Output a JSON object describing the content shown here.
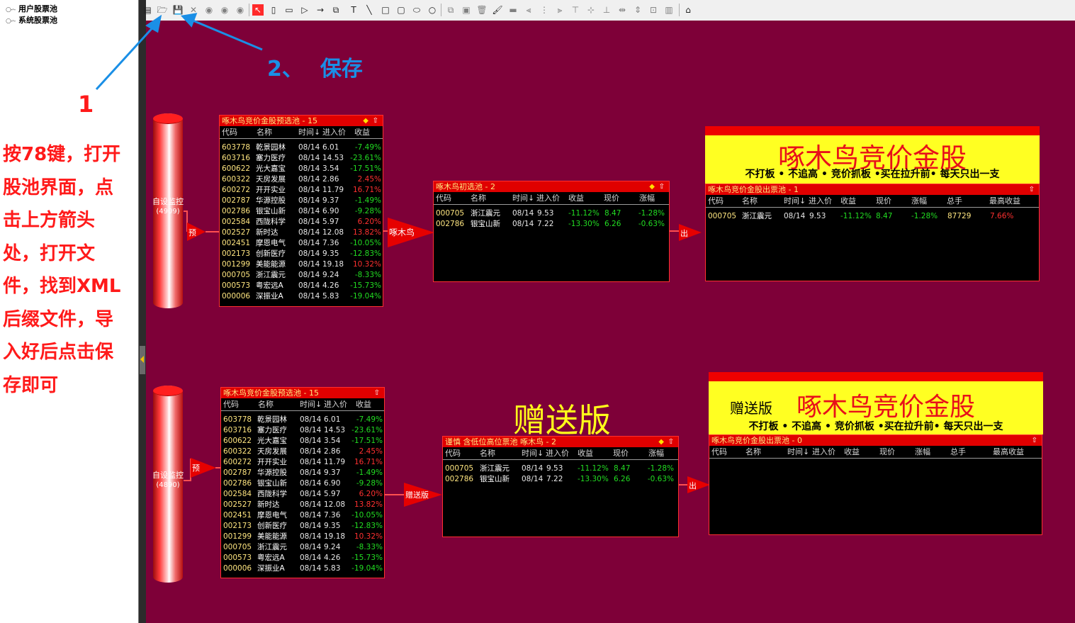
{
  "tree": {
    "items": [
      {
        "label": "用户股票池"
      },
      {
        "label": "系统股票池"
      }
    ]
  },
  "annotations": {
    "step1": "1",
    "step2_num": "2、",
    "step2_label": "保存",
    "instruction_lines": [
      "按78键，打开",
      "股池界面，点",
      "击上方箭头",
      "处，打开文",
      "件，找到XML",
      "后缀文件，导",
      "入好后点击保",
      "存即可"
    ],
    "arrow_color": "#1a8fe6",
    "text_color": "#ff1a1a"
  },
  "toolbar": {
    "icons": [
      "new-icon",
      "open-icon",
      "save-icon",
      "delete-icon",
      "play-icon",
      "pause-icon",
      "stop-icon",
      "pointer-icon",
      "cylinder-icon",
      "rect-icon",
      "triangle-icon",
      "arrow-icon",
      "panel-icon",
      "text-icon",
      "line-icon",
      "square-icon",
      "rounded-rect-icon",
      "ellipse-icon",
      "circle-icon",
      "copy-icon",
      "paste-icon",
      "trash-icon",
      "paint-icon",
      "minus-icon",
      "align-left-icon",
      "align-center-icon",
      "align-right-icon",
      "align-top-icon",
      "align-middle-icon",
      "align-bottom-icon",
      "same-width-icon",
      "same-height-icon",
      "same-size-icon",
      "grid-icon"
    ]
  },
  "canvas": {
    "background": "#7e0038",
    "gift_label": "赠送版",
    "monitors": [
      {
        "label": "自设监控",
        "count": "(4909)"
      },
      {
        "label": "自设监控",
        "count": "(4890)"
      }
    ],
    "nodes": {
      "pre1": "预",
      "pre2": "预",
      "zmn": "啄木鸟",
      "gift": "赠送版",
      "out1": "出",
      "out2": "出"
    },
    "banners": [
      {
        "title": "啄木鸟竞价金股",
        "prefix": "",
        "slogan": "不打板 • 不追高 • 竞价抓板 •买在拉升前• 每天只出一支"
      },
      {
        "title": "啄木鸟竞价金股",
        "prefix": "赠送版",
        "slogan": "不打板 • 不追高 • 竞价抓板 •买在拉升前• 每天只出一支"
      }
    ],
    "pool_columns": [
      "代码",
      "名称",
      "时间↓",
      "进入价",
      "收益"
    ],
    "pool_rows": [
      {
        "code": "603778",
        "name": "乾景园林",
        "time": "08/14",
        "price": "6.01",
        "gain": "-7.49%",
        "sign": "neg"
      },
      {
        "code": "603716",
        "name": "塞力医疗",
        "time": "08/14",
        "price": "14.53",
        "gain": "-23.61%",
        "sign": "neg"
      },
      {
        "code": "600622",
        "name": "光大嘉宝",
        "time": "08/14",
        "price": "3.54",
        "gain": "-17.51%",
        "sign": "neg"
      },
      {
        "code": "600322",
        "name": "天房发展",
        "time": "08/14",
        "price": "2.86",
        "gain": "2.45%",
        "sign": "pos"
      },
      {
        "code": "600272",
        "name": "开开实业",
        "time": "08/14",
        "price": "11.79",
        "gain": "16.71%",
        "sign": "pos"
      },
      {
        "code": "002787",
        "name": "华源控股",
        "time": "08/14",
        "price": "9.37",
        "gain": "-1.49%",
        "sign": "neg"
      },
      {
        "code": "002786",
        "name": "银宝山新",
        "time": "08/14",
        "price": "6.90",
        "gain": "-9.28%",
        "sign": "neg"
      },
      {
        "code": "002584",
        "name": "西陇科学",
        "time": "08/14",
        "price": "5.97",
        "gain": "6.20%",
        "sign": "pos"
      },
      {
        "code": "002527",
        "name": "新时达",
        "time": "08/14",
        "price": "12.08",
        "gain": "13.82%",
        "sign": "pos"
      },
      {
        "code": "002451",
        "name": "摩恩电气",
        "time": "08/14",
        "price": "7.36",
        "gain": "-10.05%",
        "sign": "neg"
      },
      {
        "code": "002173",
        "name": "创新医疗",
        "time": "08/14",
        "price": "9.35",
        "gain": "-12.83%",
        "sign": "neg"
      },
      {
        "code": "001299",
        "name": "美能能源",
        "time": "08/14",
        "price": "19.18",
        "gain": "10.32%",
        "sign": "pos"
      },
      {
        "code": "000705",
        "name": "浙江震元",
        "time": "08/14",
        "price": "9.24",
        "gain": "-8.33%",
        "sign": "neg"
      },
      {
        "code": "000573",
        "name": "粤宏远A",
        "time": "08/14",
        "price": "4.26",
        "gain": "-15.73%",
        "sign": "neg"
      },
      {
        "code": "000006",
        "name": "深振业A",
        "time": "08/14",
        "price": "5.83",
        "gain": "-19.04%",
        "sign": "neg"
      }
    ],
    "mid_columns": [
      "代码",
      "名称",
      "时间↓",
      "进入价",
      "收益",
      "现价",
      "涨幅"
    ],
    "mid_rows": [
      {
        "code": "000705",
        "name": "浙江震元",
        "time": "08/14",
        "price": "9.53",
        "gain": "-11.12%",
        "now": "8.47",
        "chg": "-1.28%"
      },
      {
        "code": "002786",
        "name": "银宝山新",
        "time": "08/14",
        "price": "7.22",
        "gain": "-13.30%",
        "now": "6.26",
        "chg": "-0.63%"
      }
    ],
    "out_columns": [
      "代码",
      "名称",
      "时间↓",
      "进入价",
      "收益",
      "现价",
      "涨幅",
      "总手",
      "最高收益"
    ],
    "out_rows": [
      {
        "code": "000705",
        "name": "浙江震元",
        "time": "08/14",
        "price": "9.53",
        "gain": "-11.12%",
        "now": "8.47",
        "chg": "-1.28%",
        "vol": "87729",
        "max": "7.66%"
      }
    ],
    "panels": {
      "pool1_title": "啄木鸟竞价金股预选池 - 15",
      "pool2_title": "啄木鸟竞价金股预选池 - 15",
      "mid1_title": "啄木鸟初选池 - 2",
      "mid2_title": "谨慎 含低位高位票池 啄木鸟 - 2",
      "out1_title": "啄木鸟竞价金股出票池 - 1",
      "out2_title": "啄木鸟竞价金股出票池 - 0"
    }
  }
}
